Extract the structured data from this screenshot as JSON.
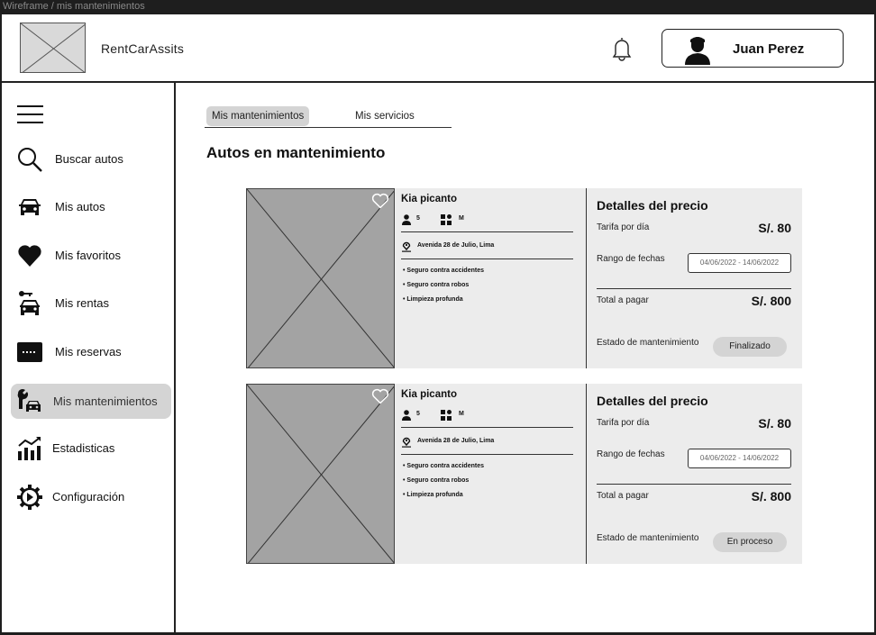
{
  "frame_label": "Wireframe / mis mantenimientos",
  "header": {
    "app_name": "RentCarAssits",
    "user_name": "Juan Perez"
  },
  "sidebar": {
    "items": [
      {
        "label": "Buscar autos",
        "icon": "search-icon"
      },
      {
        "label": "Mis autos",
        "icon": "car-icon"
      },
      {
        "label": "Mis favoritos",
        "icon": "heart-icon"
      },
      {
        "label": "Mis rentas",
        "icon": "car-key-icon"
      },
      {
        "label": "Mis reservas",
        "icon": "ticket-icon"
      },
      {
        "label": "Mis mantenimientos",
        "icon": "wrench-car-icon",
        "active": true
      },
      {
        "label": "Estadisticas",
        "icon": "chart-icon"
      },
      {
        "label": "Configuración",
        "icon": "gear-icon"
      }
    ]
  },
  "tabs": [
    {
      "label": "Mis mantenimientos",
      "active": true
    },
    {
      "label": "Mis servicios",
      "active": false
    }
  ],
  "section_title": "Autos en mantenimiento",
  "cards": [
    {
      "car_name": "Kia picanto",
      "seats": "5",
      "size": "M",
      "location": "Avenida 28 de Julio, Lima",
      "features": [
        "Seguro contra accidentes",
        "Seguro contra robos",
        "Limpieza profunda"
      ],
      "price_title": "Detalles del precio",
      "rate_label": "Tarifa por día",
      "rate_value": "S/. 80",
      "range_label": "Rango de fechas",
      "date_range": "04/06/2022 - 14/06/2022",
      "total_label": "Total a pagar",
      "total_value": "S/. 800",
      "status_label": "Estado de mantenimiento",
      "status": "Finalizado"
    },
    {
      "car_name": "Kia picanto",
      "seats": "5",
      "size": "M",
      "location": "Avenida 28 de Julio, Lima",
      "features": [
        "Seguro contra accidentes",
        "Seguro contra robos",
        "Limpieza profunda"
      ],
      "price_title": "Detalles del precio",
      "rate_label": "Tarifa por día",
      "rate_value": "S/. 80",
      "range_label": "Rango de fechas",
      "date_range": "04/06/2022 - 14/06/2022",
      "total_label": "Total a pagar",
      "total_value": "S/. 800",
      "status_label": "Estado de mantenimiento",
      "status": "En proceso"
    }
  ]
}
